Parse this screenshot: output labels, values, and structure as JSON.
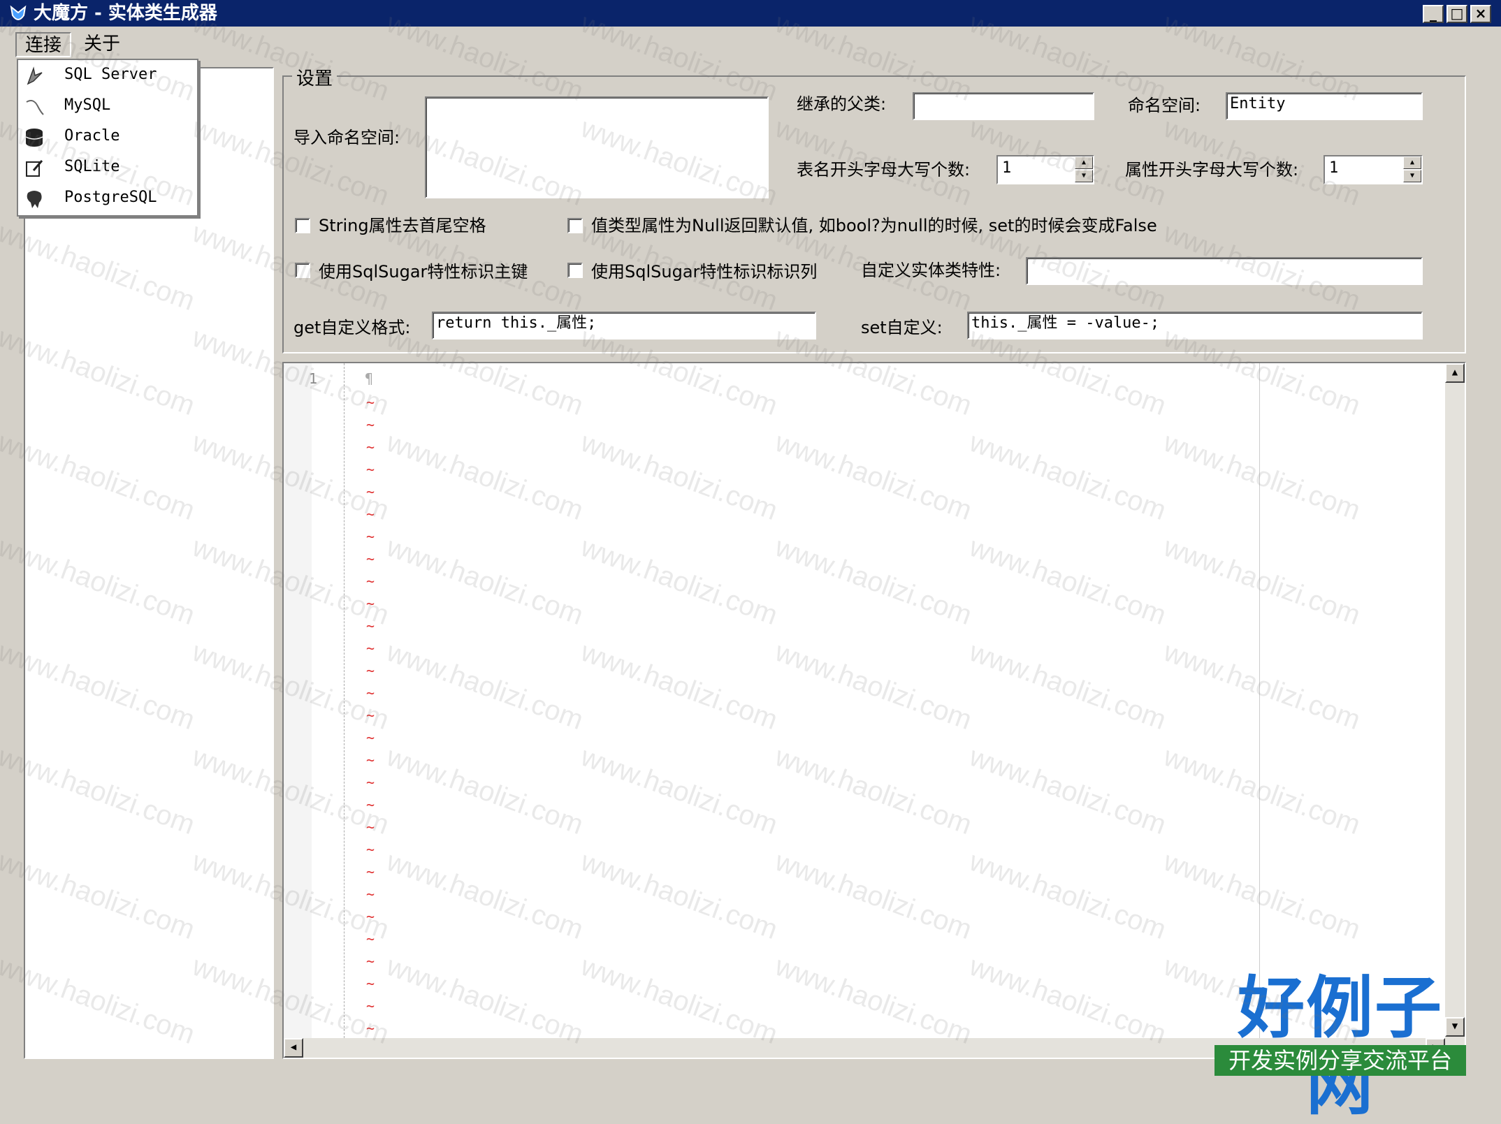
{
  "window": {
    "title": "大魔方 - 实体类生成器"
  },
  "menu": {
    "items": [
      "连接",
      "关于"
    ],
    "dropdown": [
      {
        "label": "SQL Server",
        "icon": "sqlserver-icon"
      },
      {
        "label": "MySQL",
        "icon": "mysql-icon"
      },
      {
        "label": "Oracle",
        "icon": "oracle-icon"
      },
      {
        "label": "SQLite",
        "icon": "sqlite-icon"
      },
      {
        "label": "PostgreSQL",
        "icon": "postgresql-icon"
      }
    ]
  },
  "settings": {
    "group_title": "设置",
    "import_ns_label": "导入命名空间:",
    "import_ns_value": "",
    "parent_class_label": "继承的父类:",
    "parent_class_value": "",
    "namespace_label": "命名空间:",
    "namespace_value": "Entity",
    "table_upper_label": "表名开头字母大写个数:",
    "table_upper_value": "1",
    "prop_upper_label": "属性开头字母大写个数:",
    "prop_upper_value": "1",
    "chk_trim_label": "String属性去首尾空格",
    "chk_nullable_label": "值类型属性为Null返回默认值, 如bool?为null的时候, set的时候会变成False",
    "chk_pk_label": "使用SqlSugar特性标识主键",
    "chk_identity_label": "使用SqlSugar特性标识标识列",
    "custom_attr_label": "自定义实体类特性:",
    "custom_attr_value": "",
    "get_label": "get自定义格式:",
    "get_value": "return this._属性;",
    "set_label": "set自定义:",
    "set_value": "this._属性 = -value-;"
  },
  "editor": {
    "line_number": "1",
    "pilcrow": "¶",
    "tilde": "~"
  },
  "watermark": {
    "text": "www.haolizi.com",
    "logo_big": "好例子网",
    "logo_small": "开发实例分享交流平台"
  },
  "colors": {
    "titlebar": "#0a246a",
    "face": "#d4d0c8",
    "tilde": "#e03030",
    "logo_blue": "#1a6fd1",
    "logo_green": "#2b8b3b"
  }
}
